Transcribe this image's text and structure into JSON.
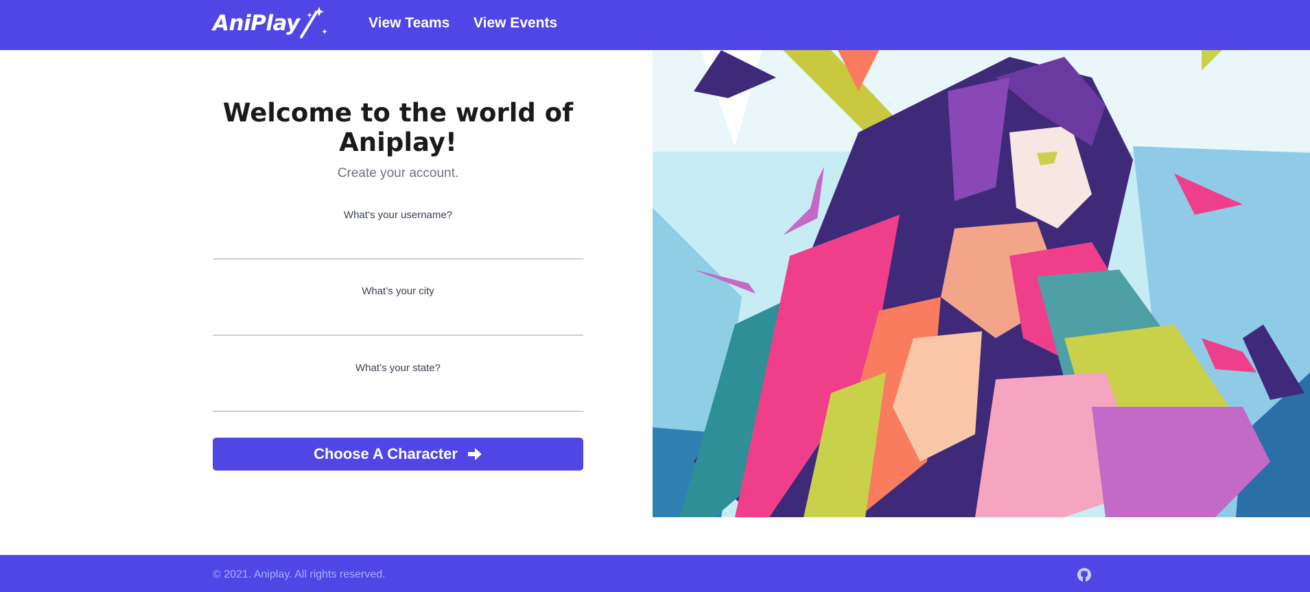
{
  "navbar": {
    "logo_text": "AniPlay",
    "links": [
      {
        "label": "View Teams"
      },
      {
        "label": "View Events"
      }
    ]
  },
  "form": {
    "title": "Welcome to the world of Aniplay!",
    "subtitle": "Create your account.",
    "fields": [
      {
        "label": "What’s your username?",
        "value": "",
        "placeholder": ""
      },
      {
        "label": "What’s your city",
        "value": "",
        "placeholder": ""
      },
      {
        "label": "What’s your state?",
        "value": "",
        "placeholder": ""
      }
    ],
    "submit_label": "Choose A Character",
    "submit_icon": "arrow-right-icon"
  },
  "hero_image": {
    "subject": "anime-character-geometric-art"
  },
  "footer": {
    "copyright": "© 2021. Aniplay. All rights reserved.",
    "social_icon": "github-icon"
  },
  "colors": {
    "brand": "#4f46e5",
    "text_dark": "#1c1917",
    "text_muted": "#6b7280",
    "footer_text": "#a5b4fc"
  }
}
